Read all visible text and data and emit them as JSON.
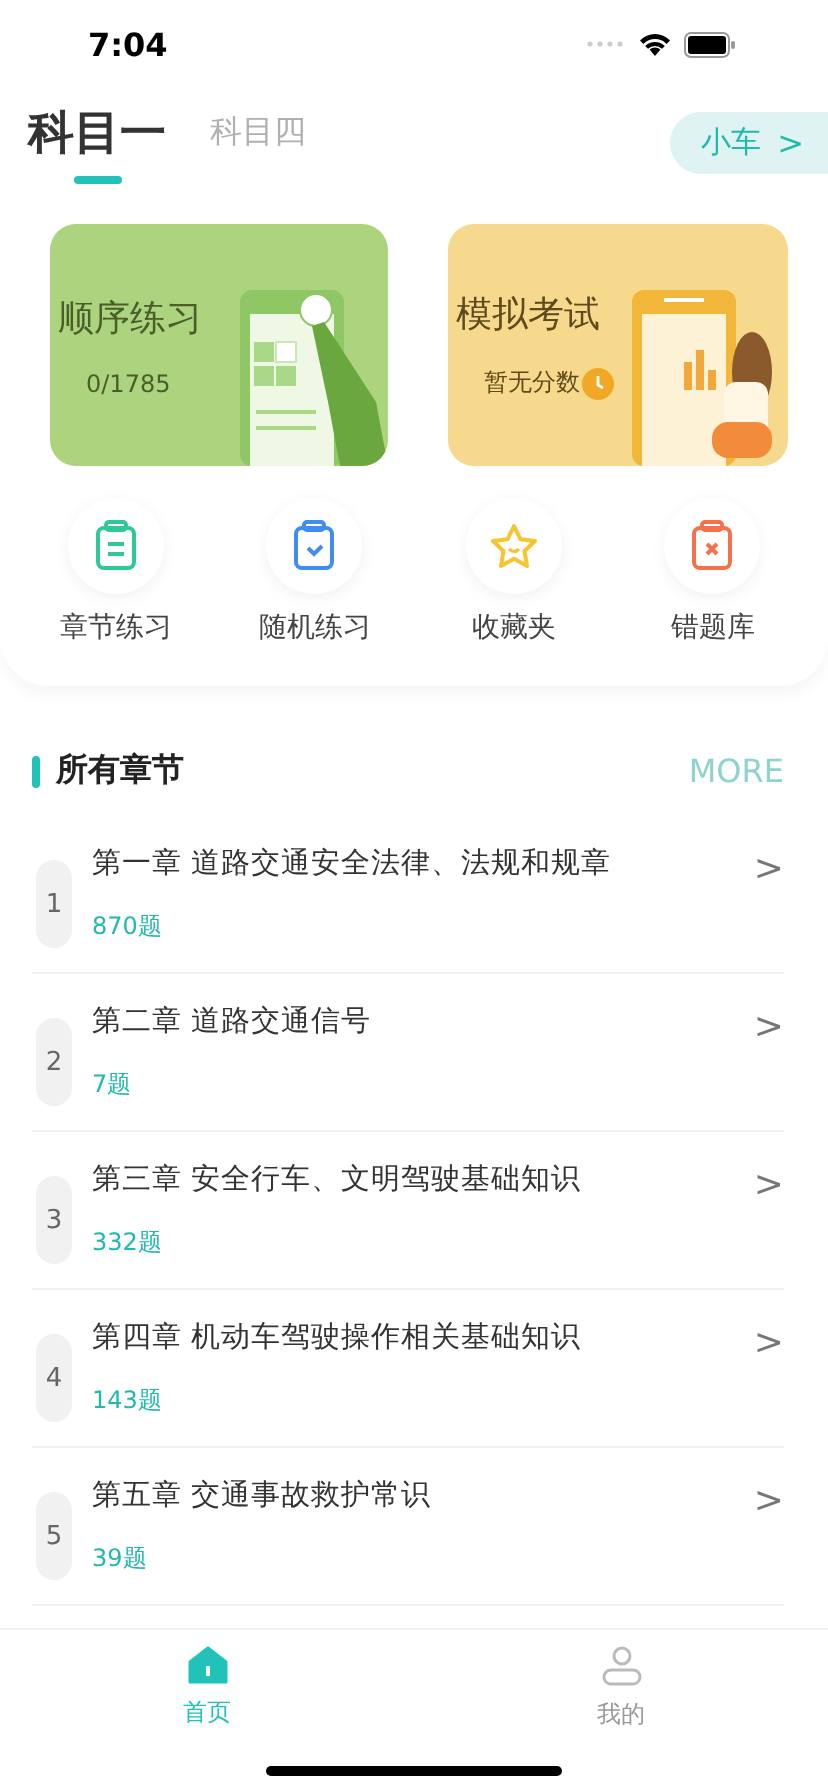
{
  "status_bar": {
    "time": "7:04"
  },
  "subject_tabs": [
    {
      "label": "科目一",
      "selected": true
    },
    {
      "label": "科目四",
      "selected": false
    }
  ],
  "vehicle_button": {
    "label": "小车",
    "arrow": ">"
  },
  "practice_cards": [
    {
      "kind": "sequence",
      "title": "顺序练习",
      "subtitle": "0/1785"
    },
    {
      "kind": "exam",
      "title": "模拟考试",
      "subtitle": "暂无分数"
    }
  ],
  "shortcuts": [
    {
      "kind": "chapter",
      "label": "章节练习"
    },
    {
      "kind": "random",
      "label": "随机练习"
    },
    {
      "kind": "favorites",
      "label": "收藏夹"
    },
    {
      "kind": "mistakes",
      "label": "错题库"
    }
  ],
  "section": {
    "title": "所有章节",
    "more": "MORE"
  },
  "chapters": [
    {
      "number": "1",
      "title": "第一章 道路交通安全法律、法规和规章",
      "count": "870题",
      "arrow": ">"
    },
    {
      "number": "2",
      "title": "第二章 道路交通信号",
      "count": "7题",
      "arrow": ">"
    },
    {
      "number": "3",
      "title": "第三章 安全行车、文明驾驶基础知识",
      "count": "332题",
      "arrow": ">"
    },
    {
      "number": "4",
      "title": "第四章 机动车驾驶操作相关基础知识",
      "count": "143题",
      "arrow": ">"
    },
    {
      "number": "5",
      "title": "第五章 交通事故救护常识",
      "count": "39题",
      "arrow": ">"
    }
  ],
  "tab_bar": [
    {
      "kind": "home",
      "label": "首页",
      "selected": true
    },
    {
      "kind": "profile",
      "label": "我的",
      "selected": false
    }
  ]
}
